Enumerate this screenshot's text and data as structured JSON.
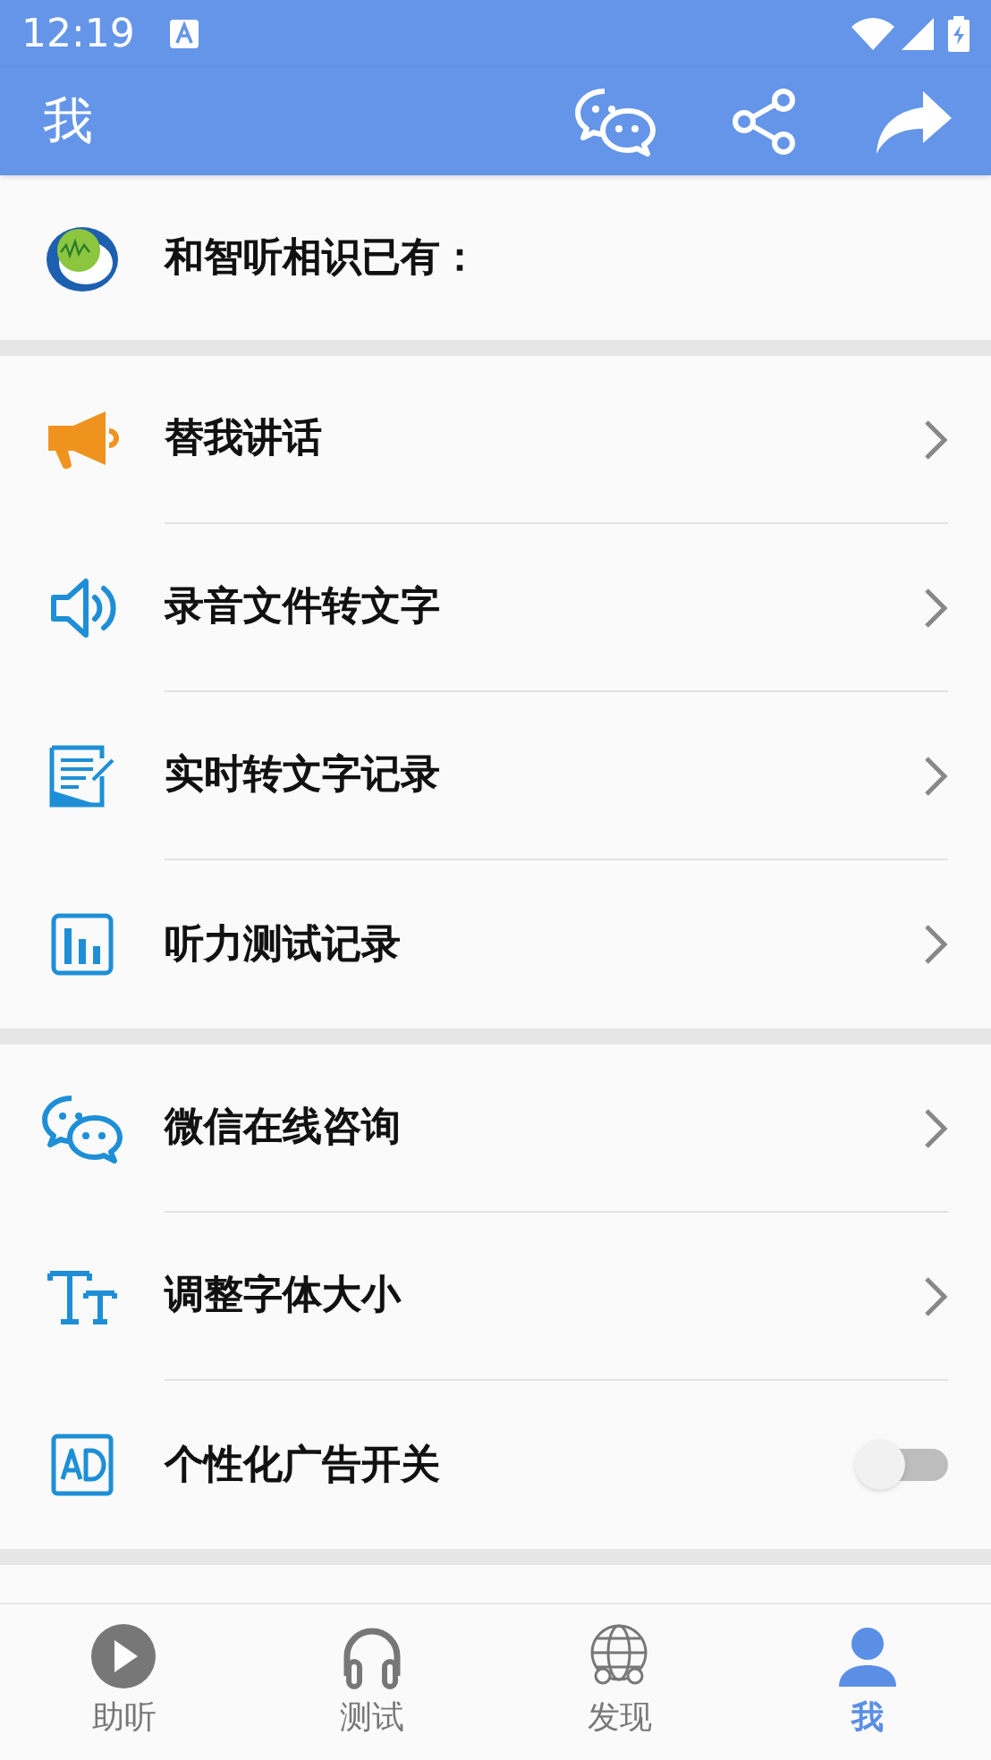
{
  "status_bar": {
    "time": "12:19"
  },
  "app_bar": {
    "title": "我"
  },
  "header": {
    "text": "和智听相识已有："
  },
  "sections": [
    {
      "items": [
        {
          "kind": "link",
          "label": "替我讲话"
        },
        {
          "kind": "link",
          "label": "录音文件转文字"
        },
        {
          "kind": "link",
          "label": "实时转文字记录"
        },
        {
          "kind": "link",
          "label": "听力测试记录"
        }
      ]
    },
    {
      "items": [
        {
          "kind": "link",
          "label": "微信在线咨询"
        },
        {
          "kind": "link",
          "label": "调整字体大小"
        },
        {
          "kind": "toggle",
          "label": "个性化广告开关",
          "on": false
        }
      ]
    }
  ],
  "bottom_nav": [
    {
      "label": "助听",
      "selected": false
    },
    {
      "label": "测试",
      "selected": false
    },
    {
      "label": "发现",
      "selected": false
    },
    {
      "label": "我",
      "selected": true
    }
  ]
}
